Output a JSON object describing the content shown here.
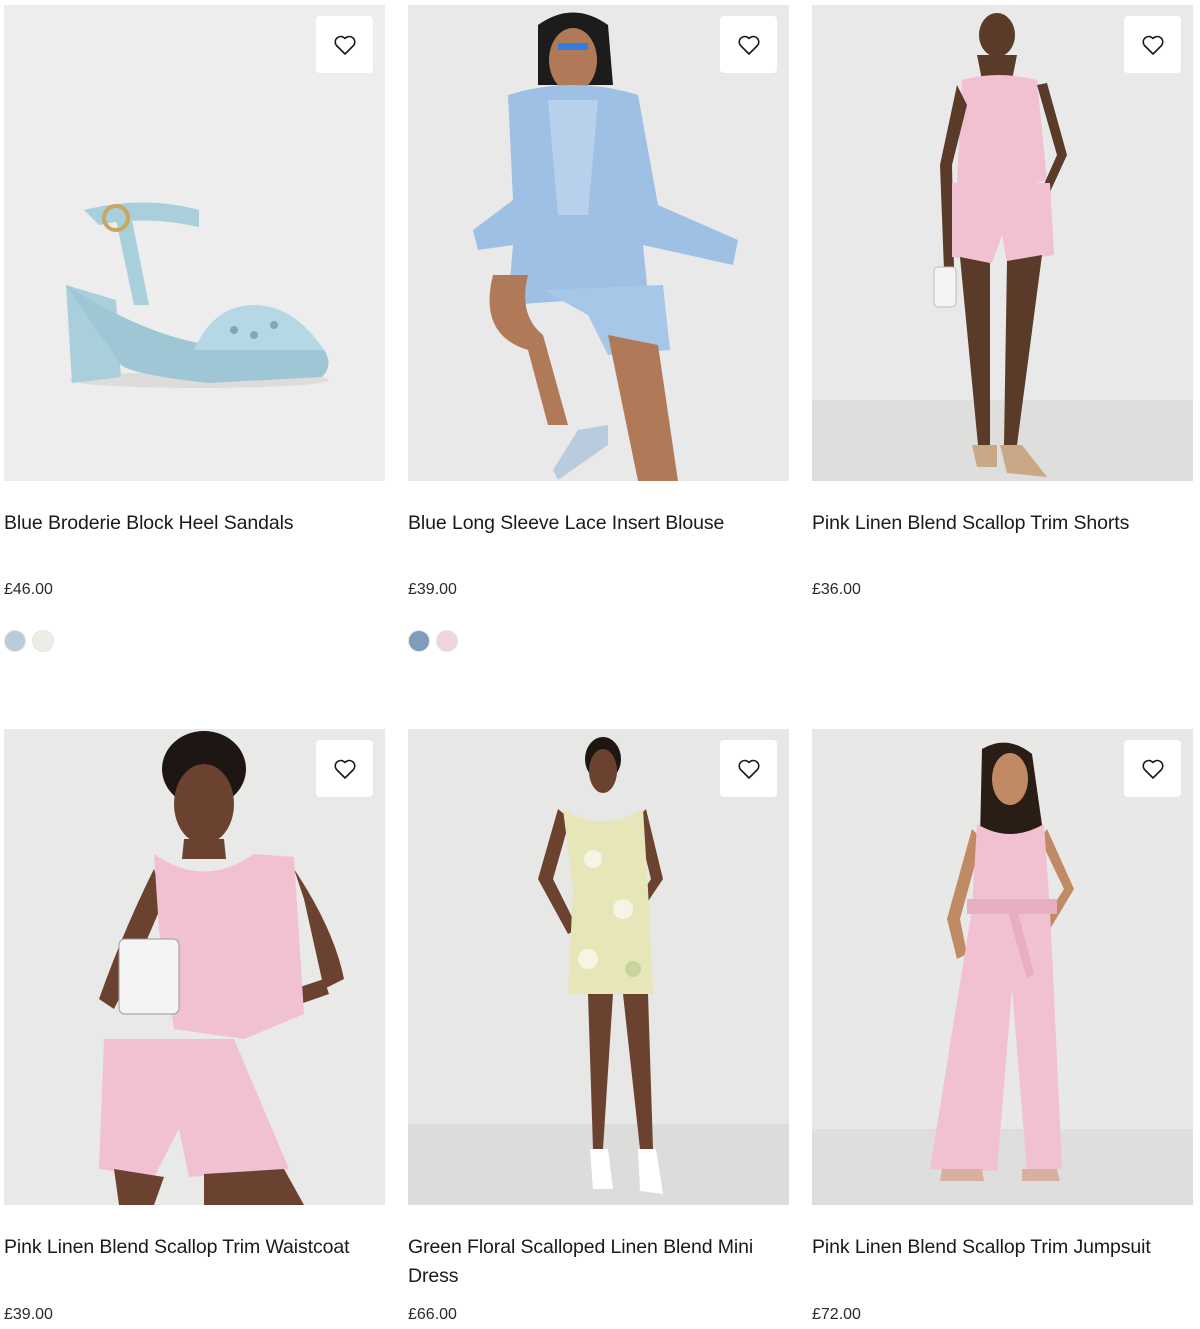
{
  "products": [
    {
      "title": "Blue Broderie Block Heel Sandals",
      "price": "£46.00",
      "image_bg": "#ededed",
      "swatches": [
        "#b9ccd9",
        "#eeece6"
      ]
    },
    {
      "title": "Blue Long Sleeve Lace Insert Blouse",
      "price": "£39.00",
      "image_bg": "#e9e9e9",
      "swatches": [
        "#7f9cbd",
        "#efd5da"
      ]
    },
    {
      "title": "Pink Linen Blend Scallop Trim Shorts",
      "price": "£36.00",
      "image_bg": "#e8e9e8",
      "swatches": []
    },
    {
      "title": "Pink Linen Blend Scallop Trim Waistcoat",
      "price": "£39.00",
      "image_bg": "#e9e9e8",
      "swatches": []
    },
    {
      "title": "Green Floral Scalloped Linen Blend Mini Dress",
      "price": "£66.00",
      "image_bg": "#e7e7e5",
      "swatches": []
    },
    {
      "title": "Pink Linen Blend Scallop Trim Jumpsuit",
      "price": "£72.00",
      "image_bg": "#e8e8e7",
      "swatches": []
    }
  ],
  "icons": {
    "wishlist": "heart-outline-icon"
  },
  "colors": {
    "text": "#1a1a1a",
    "sandal_blue": "#a9cfdc",
    "blouse_blue": "#9ec0e4",
    "linen_pink": "#f2c1d1",
    "floral_green": "#e6e6b8",
    "skin": "#8a5a3c"
  }
}
